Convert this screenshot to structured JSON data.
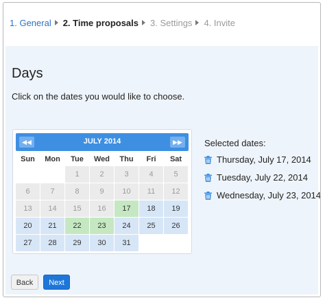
{
  "wizard": {
    "steps": [
      {
        "label": "1. General",
        "state": "active"
      },
      {
        "label": "2. Time proposals",
        "state": "current"
      },
      {
        "label": "3. Settings",
        "state": "future"
      },
      {
        "label": "4. Invite",
        "state": "future"
      }
    ]
  },
  "page": {
    "heading": "Days",
    "instruction": "Click on the dates you would like to choose."
  },
  "calendar": {
    "month_title": "JULY 2014",
    "prev_label": "◀◀",
    "next_label": "▶▶",
    "weekdays": [
      "Sun",
      "Mon",
      "Tue",
      "Wed",
      "Thu",
      "Fri",
      "Sat"
    ],
    "days": [
      {
        "label": "",
        "state": "blank"
      },
      {
        "label": "",
        "state": "blank"
      },
      {
        "label": "1",
        "state": "past"
      },
      {
        "label": "2",
        "state": "past"
      },
      {
        "label": "3",
        "state": "past"
      },
      {
        "label": "4",
        "state": "past"
      },
      {
        "label": "5",
        "state": "past"
      },
      {
        "label": "6",
        "state": "past"
      },
      {
        "label": "7",
        "state": "past"
      },
      {
        "label": "8",
        "state": "past"
      },
      {
        "label": "9",
        "state": "past"
      },
      {
        "label": "10",
        "state": "past"
      },
      {
        "label": "11",
        "state": "past"
      },
      {
        "label": "12",
        "state": "past"
      },
      {
        "label": "13",
        "state": "past"
      },
      {
        "label": "14",
        "state": "past"
      },
      {
        "label": "15",
        "state": "past"
      },
      {
        "label": "16",
        "state": "past"
      },
      {
        "label": "17",
        "state": "selected"
      },
      {
        "label": "18",
        "state": "available"
      },
      {
        "label": "19",
        "state": "available"
      },
      {
        "label": "20",
        "state": "available"
      },
      {
        "label": "21",
        "state": "available"
      },
      {
        "label": "22",
        "state": "selected"
      },
      {
        "label": "23",
        "state": "selected"
      },
      {
        "label": "24",
        "state": "available"
      },
      {
        "label": "25",
        "state": "available"
      },
      {
        "label": "26",
        "state": "available"
      },
      {
        "label": "27",
        "state": "available"
      },
      {
        "label": "28",
        "state": "available"
      },
      {
        "label": "29",
        "state": "available"
      },
      {
        "label": "30",
        "state": "available"
      },
      {
        "label": "31",
        "state": "available"
      }
    ]
  },
  "selected": {
    "title": "Selected dates:",
    "dates": [
      "Thursday, July 17, 2014",
      "Tuesday, July 22, 2014",
      "Wednesday, July 23, 2014"
    ]
  },
  "actions": {
    "back_label": "Back",
    "next_label": "Next"
  },
  "colors": {
    "accent": "#3e8fe2",
    "selected_day": "#c5e8c2",
    "available_day": "#d7e6f7",
    "past_day": "#ebebeb",
    "next_button": "#1f76d9"
  },
  "icons": {
    "delete_date": "trash-icon",
    "step_separator": "triangle-right-icon"
  }
}
